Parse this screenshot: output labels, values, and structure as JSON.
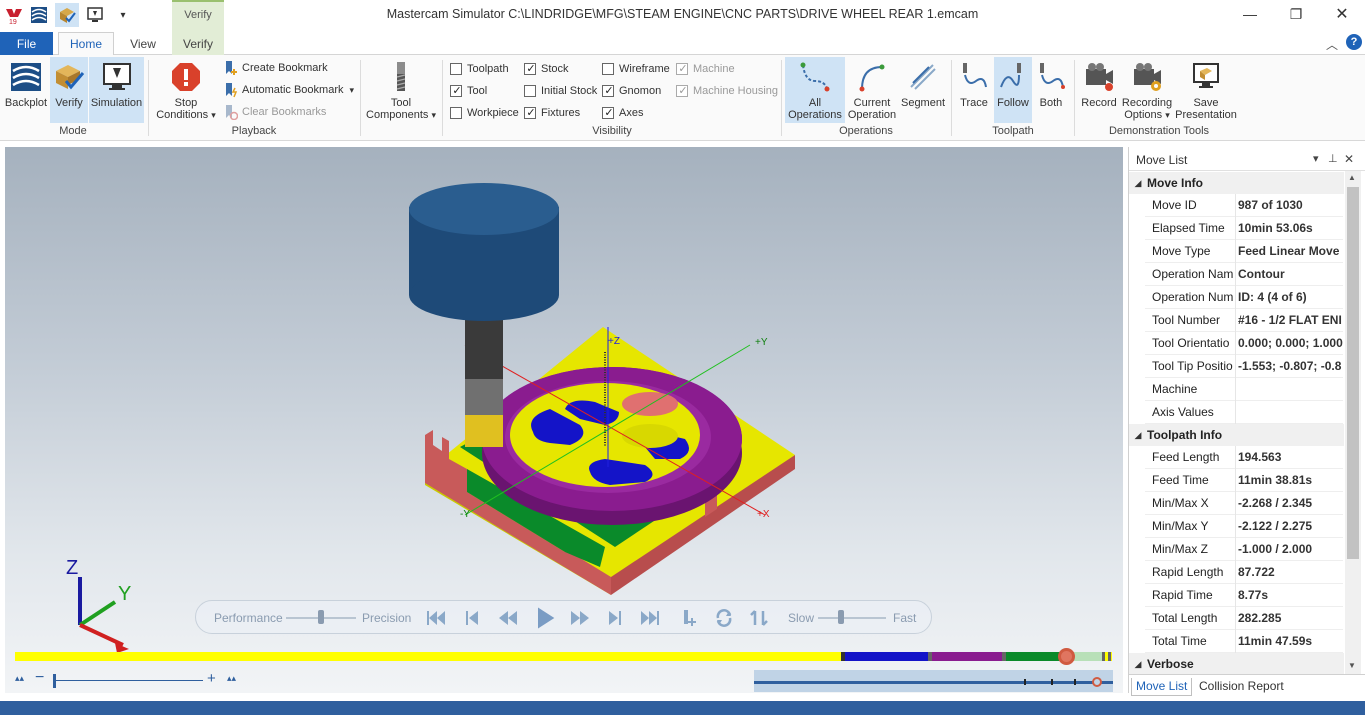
{
  "window": {
    "title": "Mastercam Simulator  C:\\LINDRIDGE\\MFG\\STEAM ENGINE\\CNC PARTS\\DRIVE WHEEL REAR 1.emcam",
    "contextual_tab_header": "Verify"
  },
  "tabs": [
    {
      "label": "File"
    },
    {
      "label": "Home"
    },
    {
      "label": "View"
    },
    {
      "label": "Verify"
    }
  ],
  "ribbon": {
    "mode": {
      "label": "Mode",
      "backplot": "Backplot",
      "verify": "Verify",
      "simulation": "Simulation"
    },
    "playback": {
      "label": "Playback",
      "stop_conditions_1": "Stop",
      "stop_conditions_2": "Conditions",
      "create_bookmark": "Create Bookmark",
      "automatic_bookmark": "Automatic Bookmark",
      "clear_bookmarks": "Clear Bookmarks"
    },
    "tool_components_1": "Tool",
    "tool_components_2": "Components",
    "visibility": {
      "label": "Visibility",
      "toolpath": "Toolpath",
      "tool": "Tool",
      "workpiece": "Workpiece",
      "stock": "Stock",
      "initial_stock": "Initial Stock",
      "fixtures": "Fixtures",
      "wireframe": "Wireframe",
      "gnomon": "Gnomon",
      "axes": "Axes",
      "machine": "Machine",
      "machine_housing": "Machine Housing"
    },
    "operations": {
      "label": "Operations",
      "all_1": "All",
      "all_2": "Operations",
      "current_1": "Current",
      "current_2": "Operation",
      "segment": "Segment"
    },
    "toolpath": {
      "label": "Toolpath",
      "trace": "Trace",
      "follow": "Follow",
      "both": "Both"
    },
    "demo": {
      "label": "Demonstration Tools",
      "record": "Record",
      "recording_1": "Recording",
      "recording_2": "Options",
      "save_1": "Save",
      "save_2": "Presentation"
    }
  },
  "axes_labels": {
    "z": "+Z",
    "y": "+Y",
    "x": "+X",
    "neg_y": "-Y",
    "gnomon_z": "Z",
    "gnomon_y": "Y"
  },
  "playback_bar": {
    "performance": "Performance",
    "precision": "Precision",
    "slow": "Slow",
    "fast": "Fast"
  },
  "timeline": {
    "progress": 0.958
  },
  "move_list": {
    "title": "Move List",
    "move_info_label": "Move Info",
    "move_info": [
      {
        "key": "Move ID",
        "value": "987 of 1030"
      },
      {
        "key": "Elapsed Time",
        "value": "10min 53.06s"
      },
      {
        "key": "Move Type",
        "value": "Feed Linear Move"
      },
      {
        "key": "Operation Nam",
        "value": "Contour"
      },
      {
        "key": "Operation Num",
        "value": "ID: 4 (4 of 6)"
      },
      {
        "key": "Tool Number",
        "value": "#16 - 1/2 FLAT ENI"
      },
      {
        "key": "Tool Orientatio",
        "value": "0.000; 0.000; 1.000"
      },
      {
        "key": "Tool Tip Positio",
        "value": "-1.553; -0.807; -0.8"
      },
      {
        "key": "Machine",
        "value": ""
      },
      {
        "key": "Axis Values",
        "value": ""
      }
    ],
    "toolpath_info_label": "Toolpath Info",
    "toolpath_info": [
      {
        "key": "Feed Length",
        "value": "194.563"
      },
      {
        "key": "Feed Time",
        "value": "11min 38.81s"
      },
      {
        "key": "Min/Max X",
        "value": "-2.268 / 2.345"
      },
      {
        "key": "Min/Max Y",
        "value": "-2.122 / 2.275"
      },
      {
        "key": "Min/Max Z",
        "value": "-1.000 / 2.000"
      },
      {
        "key": "Rapid Length",
        "value": "87.722"
      },
      {
        "key": "Rapid Time",
        "value": "8.77s"
      },
      {
        "key": "Total Length",
        "value": "282.285"
      },
      {
        "key": "Total Time",
        "value": "11min 47.59s"
      }
    ],
    "verbose_label": "Verbose",
    "tab_move_list": "Move List",
    "tab_collision": "Collision Report"
  }
}
